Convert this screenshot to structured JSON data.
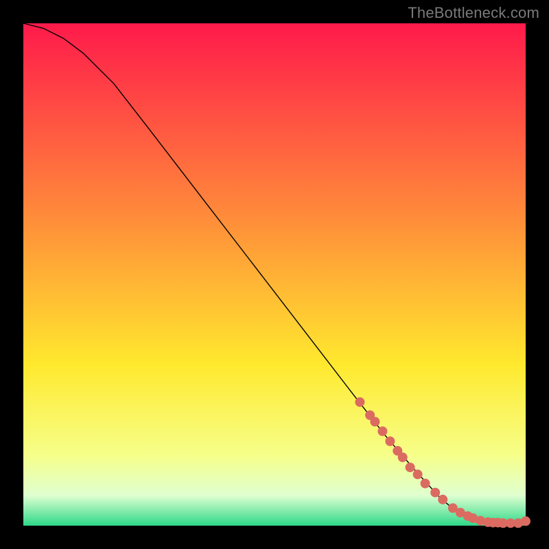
{
  "attribution": "TheBottleneck.com",
  "gradient": {
    "top": "#ff1a4b",
    "mid1": "#ff8a3a",
    "mid2": "#ffe92e",
    "low1": "#f6ff8a",
    "low2": "#dfffd0",
    "bottom": "#2dd889"
  },
  "chart_data": {
    "type": "line",
    "title": "",
    "xlabel": "",
    "ylabel": "",
    "xlim": [
      0,
      100
    ],
    "ylim": [
      0,
      100
    ],
    "series": [
      {
        "name": "curve",
        "x": [
          0,
          4,
          8,
          12,
          18,
          25,
          35,
          45,
          55,
          65,
          72,
          78,
          83,
          86,
          88,
          90,
          92,
          94,
          96,
          98,
          100
        ],
        "values": [
          100,
          99,
          97,
          94,
          88,
          79,
          66,
          53,
          40,
          27,
          18,
          11,
          5.5,
          3.0,
          2.0,
          1.2,
          0.8,
          0.6,
          0.5,
          0.5,
          0.9
        ]
      }
    ],
    "markers": {
      "name": "highlighted-points",
      "x": [
        67,
        69,
        70,
        71.5,
        73,
        74.5,
        75.5,
        77,
        78.5,
        80,
        82,
        83.5,
        85.5,
        87,
        88.5,
        89.5,
        91,
        92.5,
        93.5,
        94.5,
        95.5,
        97,
        98.5,
        100
      ],
      "values": [
        24.6,
        22.0,
        20.7,
        18.8,
        16.8,
        14.9,
        13.6,
        11.6,
        10.2,
        8.4,
        6.6,
        5.2,
        3.5,
        2.6,
        1.9,
        1.5,
        1.0,
        0.7,
        0.6,
        0.6,
        0.5,
        0.5,
        0.5,
        0.9
      ]
    }
  }
}
